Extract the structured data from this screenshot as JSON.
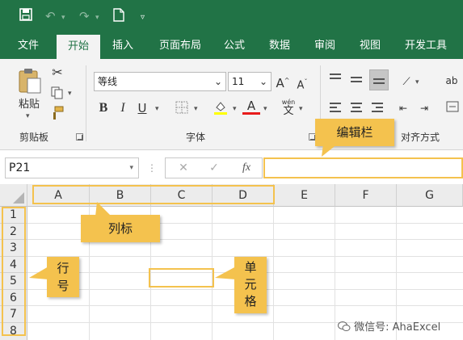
{
  "quick_access": {
    "save_icon": "save-icon",
    "undo_icon": "undo-icon",
    "redo_icon": "redo-icon",
    "new_icon": "new-file-icon",
    "customize_icon": "customize-caret-icon"
  },
  "tabs": [
    {
      "label": "文件"
    },
    {
      "label": "开始"
    },
    {
      "label": "插入"
    },
    {
      "label": "页面布局"
    },
    {
      "label": "公式"
    },
    {
      "label": "数据"
    },
    {
      "label": "审阅"
    },
    {
      "label": "视图"
    },
    {
      "label": "开发工具"
    }
  ],
  "ribbon": {
    "clipboard": {
      "paste_label": "粘贴",
      "group_label": "剪贴板"
    },
    "font": {
      "font_name": "等线",
      "font_size": "11",
      "grow_label": "A",
      "shrink_label": "A",
      "bold": "B",
      "italic": "I",
      "underline": "U",
      "font_color_label": "A",
      "phonetic_top": "wén",
      "phonetic_bottom": "文",
      "group_label": "字体"
    },
    "alignment": {
      "group_label": "对齐方式",
      "wrap_label": "ab"
    }
  },
  "formula_bar": {
    "name_box": "P21",
    "fx_label": "fx",
    "cancel_label": "✕",
    "enter_label": "✓",
    "formula_value": ""
  },
  "grid": {
    "columns": [
      "A",
      "B",
      "C",
      "D",
      "E",
      "F",
      "G"
    ],
    "rows": [
      "1",
      "2",
      "3",
      "4",
      "5",
      "6",
      "7",
      "8"
    ]
  },
  "annotations": {
    "formula_bar_label": "编辑栏",
    "column_header_label": "列标",
    "row_header_label_1": "行",
    "row_header_label_2": "号",
    "cell_label_1": "单",
    "cell_label_2": "元",
    "cell_label_3": "格"
  },
  "watermark": "微信号: AhaExcel",
  "colors": {
    "accent": "#217346",
    "callout": "#f4c24e",
    "ribbon_bg": "#f3f3f3"
  }
}
